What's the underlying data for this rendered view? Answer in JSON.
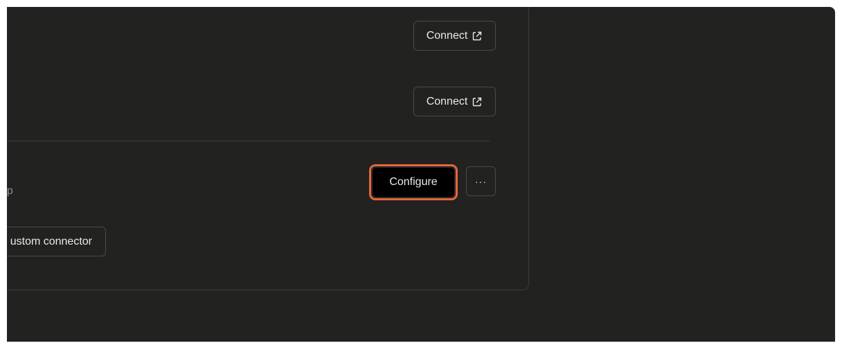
{
  "connectors": {
    "item_1": {
      "button_label": "Connect"
    },
    "item_2": {
      "button_label": "Connect"
    },
    "custom": {
      "url_fragment": "ncp",
      "configure_label": "Configure",
      "more_label": "···"
    },
    "add_custom_label": "ustom connector"
  },
  "icons": {
    "external": "external-link-icon",
    "more": "more-options-icon"
  },
  "colors": {
    "background": "#222221",
    "highlight": "#e8653c",
    "configure_bg": "#000000"
  }
}
